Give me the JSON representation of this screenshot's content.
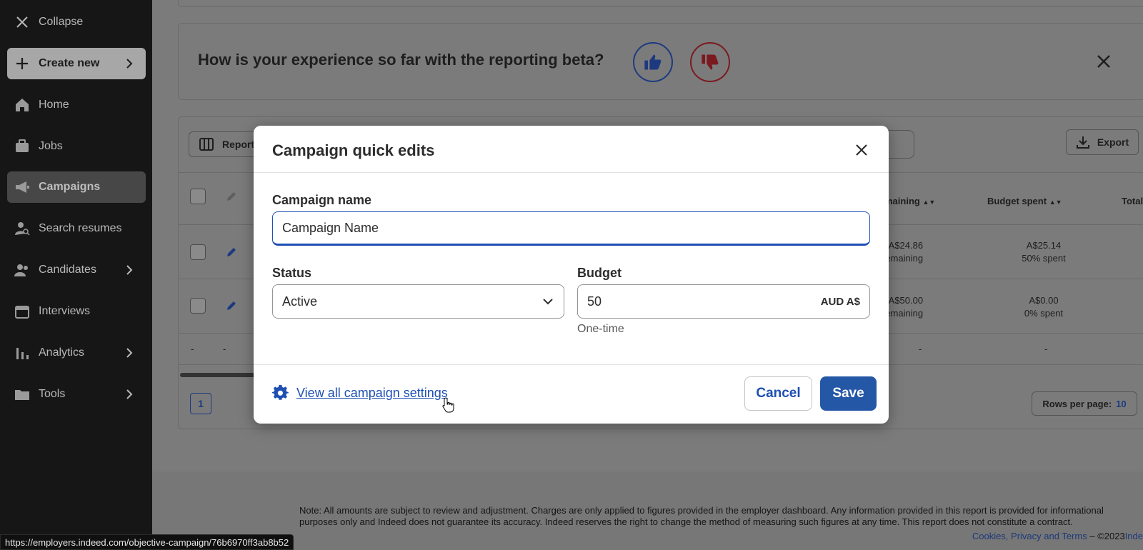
{
  "colors": {
    "accent": "#2557a7",
    "sidebar_bg": "#161616",
    "overlay": "#7b7b7b"
  },
  "sidebar": {
    "items": [
      {
        "label": "Collapse",
        "icon": "close-icon"
      },
      {
        "label": "Create new",
        "icon": "plus-icon",
        "chevron": true
      },
      {
        "label": "Home",
        "icon": "home-icon"
      },
      {
        "label": "Jobs",
        "icon": "briefcase-icon"
      },
      {
        "label": "Campaigns",
        "icon": "megaphone-icon",
        "active": true
      },
      {
        "label": "Search resumes",
        "icon": "person-search-icon"
      },
      {
        "label": "Candidates",
        "icon": "people-icon",
        "chevron": true
      },
      {
        "label": "Interviews",
        "icon": "calendar-icon"
      },
      {
        "label": "Analytics",
        "icon": "bar-chart-icon",
        "chevron": true
      },
      {
        "label": "Tools",
        "icon": "folder-icon",
        "chevron": true
      }
    ]
  },
  "feedback": {
    "question": "How is your experience so far with the reporting beta?"
  },
  "toolbar": {
    "report_label": "Report",
    "export_label": "Export"
  },
  "table": {
    "headers": {
      "remaining": "maining",
      "budget_spent": "Budget spent",
      "total": "Total"
    },
    "rows": [
      {
        "remaining_amount": "A$24.86",
        "remaining_text": "remaining",
        "spent_amount": "A$25.14",
        "spent_text": "50% spent"
      },
      {
        "remaining_amount": "A$50.00",
        "remaining_text": "remaining",
        "spent_amount": "A$0.00",
        "spent_text": "0% spent"
      }
    ],
    "totals_dash": "-",
    "page": "1",
    "rows_per_page_label": "Rows per page:",
    "rows_per_page_value": "10"
  },
  "modal": {
    "title": "Campaign quick edits",
    "campaign_name_label": "Campaign name",
    "campaign_name_value": "Campaign Name",
    "status_label": "Status",
    "status_value": "Active",
    "budget_label": "Budget",
    "budget_value": "50",
    "currency": "AUD A$",
    "budget_hint": "One-time",
    "settings_link": "View all campaign settings",
    "cancel_label": "Cancel",
    "save_label": "Save"
  },
  "footer": {
    "note": "Note: All amounts are subject to review and adjustment. Charges are only applied to figures provided in the employer dashboard. Any information provided in this report is provided for informational purposes only and Indeed does not guarantee its accuracy. Indeed reserves the right to change the method of measuring such figures at any time. This report does not constitute a contract.",
    "links": "Cookies, Privacy and Terms",
    "copyright": "©2023",
    "brand": "Inde"
  },
  "status_bar": {
    "url": "https://employers.indeed.com/objective-campaign/76b6970ff3ab8b52"
  }
}
